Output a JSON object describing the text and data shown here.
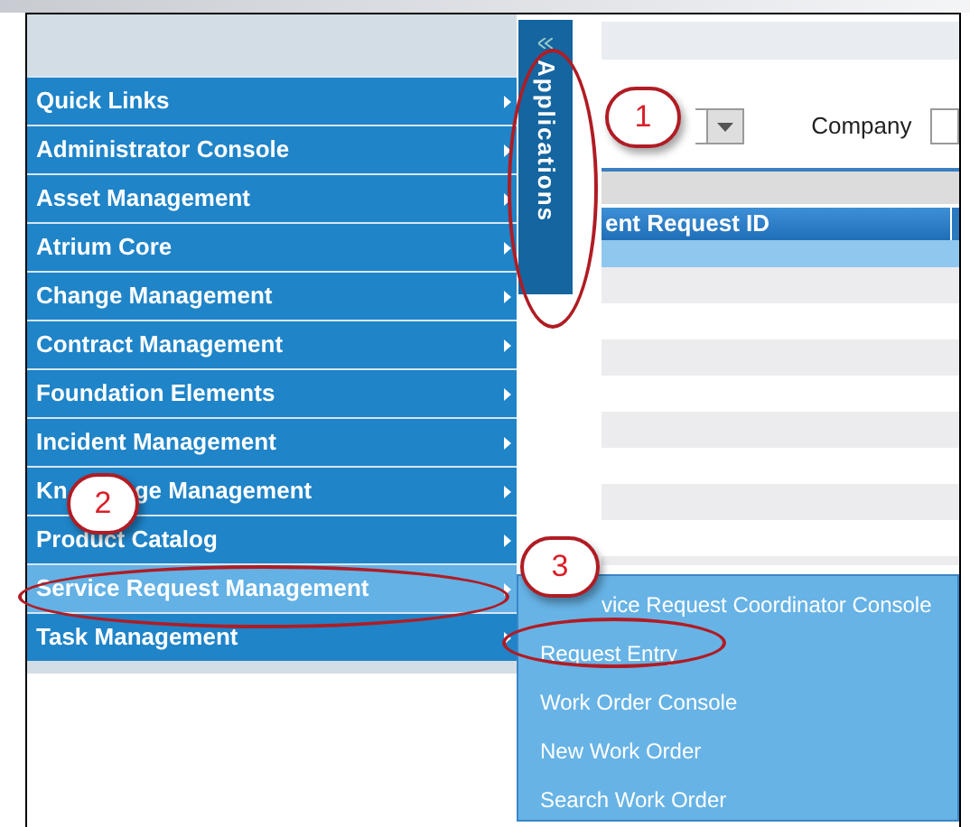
{
  "menu": {
    "items": [
      {
        "label": "Quick Links",
        "selected": false
      },
      {
        "label": "Administrator Console",
        "selected": false
      },
      {
        "label": "Asset Management",
        "selected": false
      },
      {
        "label": "Atrium Core",
        "selected": false
      },
      {
        "label": "Change Management",
        "selected": false
      },
      {
        "label": "Contract Management",
        "selected": false
      },
      {
        "label": "Foundation Elements",
        "selected": false
      },
      {
        "label": "Incident Management",
        "selected": false
      },
      {
        "label": "Kn",
        "label_tail": "ge Management",
        "selected": false
      },
      {
        "label": "Product Catalog",
        "selected": false
      },
      {
        "label": "Service Request Management",
        "selected": true
      },
      {
        "label": "Task Management",
        "selected": false
      }
    ]
  },
  "applications_tab": {
    "label": "Applications"
  },
  "toolbar": {
    "company_label": "Company"
  },
  "table": {
    "columns": [
      {
        "label": "ent Request ID"
      }
    ],
    "rows": [
      {
        "selected": true
      },
      {
        "selected": false
      },
      {
        "selected": false
      },
      {
        "selected": false
      },
      {
        "selected": false
      },
      {
        "selected": false
      },
      {
        "selected": false
      },
      {
        "selected": false
      },
      {
        "selected": false
      },
      {
        "selected": false
      }
    ]
  },
  "submenu": {
    "items": [
      {
        "label": "vice Request Coordinator Console"
      },
      {
        "label": "Request Entry"
      },
      {
        "label": "Work Order Console"
      },
      {
        "label": "New Work Order"
      },
      {
        "label": "Search Work Order"
      }
    ]
  },
  "callouts": [
    {
      "label": "1"
    },
    {
      "label": "2"
    },
    {
      "label": "3"
    }
  ]
}
